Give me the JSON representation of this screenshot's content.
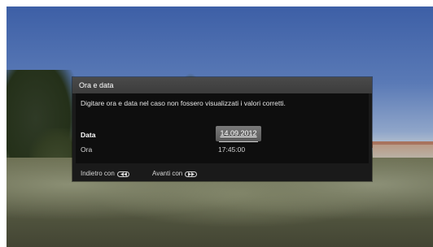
{
  "dialog": {
    "title": "Ora e data",
    "description": "Digitare ora e data nel caso non fossero visualizzati i valori corretti.",
    "fields": [
      {
        "label": "Data",
        "value": "14.09.2012"
      },
      {
        "label": "Ora",
        "value": "17:45:00"
      }
    ],
    "footer": {
      "back_label": "Indietro con",
      "forward_label": "Avanti con"
    }
  },
  "icons": {
    "back": "rewind-key-icon",
    "forward": "fast-forward-key-icon"
  },
  "colors": {
    "title_bar": "#404040",
    "dialog_bg": "#1a1a1a",
    "body_bg": "#0e0e0e",
    "selected_field": "#6a6a6a"
  }
}
